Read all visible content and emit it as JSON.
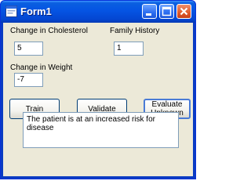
{
  "window": {
    "title": "Form1"
  },
  "labels": {
    "cholesterol": "Change in Cholesterol",
    "family_history": "Family History",
    "weight": "Change in Weight"
  },
  "fields": {
    "cholesterol_value": "5",
    "family_history_value": "1",
    "weight_value": "-7"
  },
  "buttons": {
    "train": "Train",
    "validate": "Validate",
    "evaluate_line1": "Evaluate",
    "evaluate_line2": "Unknown"
  },
  "output": {
    "message": "The patient is at an increased risk for disease"
  },
  "colors": {
    "titlebar": "#0554e3",
    "client_bg": "#ece9d8",
    "field_border": "#7f9db9"
  }
}
